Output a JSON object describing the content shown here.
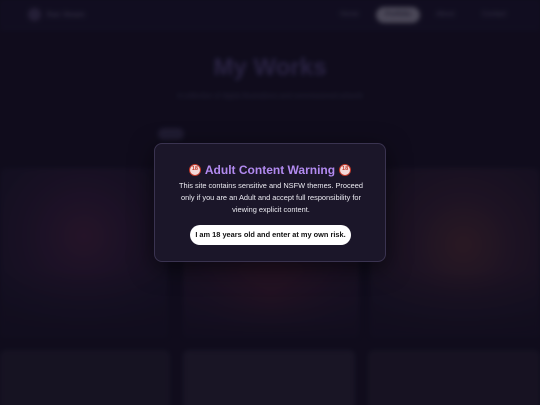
{
  "nav": {
    "brand": "Xeo Vexen",
    "links": [
      "Home",
      "Portfolio",
      "About",
      "Contact"
    ]
  },
  "page": {
    "title": "My Works",
    "subtitle": "A collection of digital illustrations and commissioned artwork"
  },
  "modal": {
    "icon": "no-under-18-icon",
    "icon_text": "18",
    "title": "Adult Content Warning",
    "message": "This site contains sensitive and NSFW themes. Proceed only if you are an Adult and accept full responsibility for viewing explicit content.",
    "button_label": "I am 18 years old and enter at my own risk."
  },
  "colors": {
    "background": "#141022",
    "modal_bg": "#1b1629",
    "title_accent": "#b28af0",
    "button_bg": "#ffffff"
  }
}
